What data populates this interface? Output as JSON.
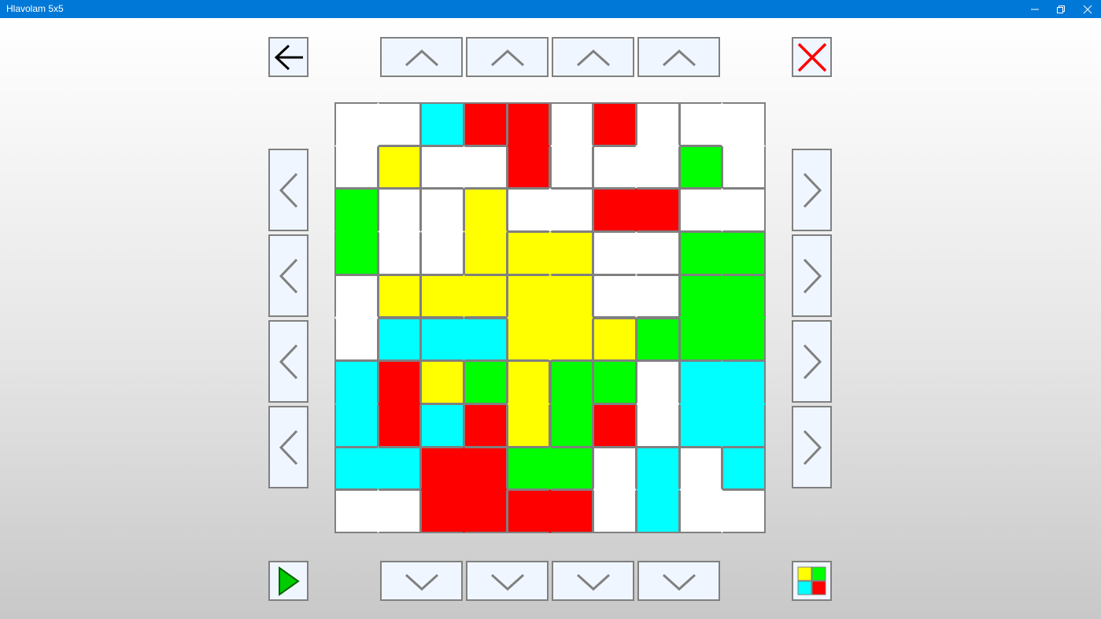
{
  "window": {
    "title": "Hlavolam 5x5",
    "controls": [
      "minimize-icon",
      "restore-icon",
      "close-icon"
    ]
  },
  "toolbar": {
    "back_icon": "arrow-left-icon",
    "close_icon": "red-x-icon",
    "play_icon": "green-play-icon",
    "colors_icon": "four-color-squares-icon"
  },
  "colors": {
    "white": "#ffffff",
    "cyan": "#00ffff",
    "red": "#ff0000",
    "yellow": "#ffff00",
    "green": "#00ff00",
    "title_bar": "#0078d7",
    "button_face": "#f0f6ff",
    "border": "#808080"
  },
  "board": {
    "grid_cells": 10,
    "pieces": [
      {
        "color": "white",
        "cells": [
          [
            0,
            0
          ],
          [
            0,
            1
          ],
          [
            1,
            0
          ]
        ]
      },
      {
        "color": "cyan",
        "cells": [
          [
            0,
            2
          ]
        ]
      },
      {
        "color": "red",
        "cells": [
          [
            0,
            3
          ]
        ]
      },
      {
        "color": "red",
        "cells": [
          [
            0,
            4
          ],
          [
            1,
            4
          ]
        ]
      },
      {
        "color": "white",
        "cells": [
          [
            0,
            5
          ],
          [
            1,
            5
          ]
        ]
      },
      {
        "color": "red",
        "cells": [
          [
            0,
            6
          ]
        ]
      },
      {
        "color": "white",
        "cells": [
          [
            0,
            7
          ],
          [
            1,
            6
          ],
          [
            1,
            7
          ]
        ]
      },
      {
        "color": "white",
        "cells": [
          [
            0,
            8
          ],
          [
            0,
            9
          ],
          [
            1,
            9
          ]
        ]
      },
      {
        "color": "yellow",
        "cells": [
          [
            1,
            1
          ]
        ]
      },
      {
        "color": "white",
        "cells": [
          [
            1,
            2
          ],
          [
            1,
            3
          ]
        ]
      },
      {
        "color": "green",
        "cells": [
          [
            1,
            8
          ]
        ]
      },
      {
        "color": "green",
        "cells": [
          [
            2,
            0
          ],
          [
            3,
            0
          ]
        ]
      },
      {
        "color": "white",
        "cells": [
          [
            2,
            1
          ],
          [
            3,
            1
          ]
        ]
      },
      {
        "color": "white",
        "cells": [
          [
            2,
            2
          ],
          [
            3,
            2
          ]
        ]
      },
      {
        "color": "yellow",
        "cells": [
          [
            2,
            3
          ],
          [
            3,
            3
          ]
        ]
      },
      {
        "color": "white",
        "cells": [
          [
            2,
            4
          ],
          [
            2,
            5
          ]
        ]
      },
      {
        "color": "red",
        "cells": [
          [
            2,
            6
          ],
          [
            2,
            7
          ]
        ]
      },
      {
        "color": "white",
        "cells": [
          [
            2,
            8
          ],
          [
            2,
            9
          ]
        ]
      },
      {
        "color": "yellow",
        "cells": [
          [
            3,
            4
          ],
          [
            3,
            5
          ]
        ]
      },
      {
        "color": "white",
        "cells": [
          [
            3,
            6
          ],
          [
            3,
            7
          ]
        ]
      },
      {
        "color": "green",
        "cells": [
          [
            3,
            8
          ],
          [
            3,
            9
          ]
        ]
      },
      {
        "color": "white",
        "cells": [
          [
            4,
            0
          ],
          [
            5,
            0
          ]
        ]
      },
      {
        "color": "yellow",
        "cells": [
          [
            4,
            1
          ]
        ]
      },
      {
        "color": "yellow",
        "cells": [
          [
            4,
            2
          ],
          [
            4,
            3
          ]
        ]
      },
      {
        "color": "yellow",
        "cells": [
          [
            4,
            4
          ],
          [
            4,
            5
          ],
          [
            5,
            4
          ],
          [
            5,
            5
          ]
        ]
      },
      {
        "color": "white",
        "cells": [
          [
            4,
            6
          ],
          [
            4,
            7
          ]
        ]
      },
      {
        "color": "green",
        "cells": [
          [
            4,
            8
          ],
          [
            4,
            9
          ],
          [
            5,
            8
          ],
          [
            5,
            9
          ]
        ]
      },
      {
        "color": "cyan",
        "cells": [
          [
            5,
            1
          ]
        ]
      },
      {
        "color": "cyan",
        "cells": [
          [
            5,
            2
          ],
          [
            5,
            3
          ]
        ]
      },
      {
        "color": "yellow",
        "cells": [
          [
            5,
            6
          ]
        ]
      },
      {
        "color": "green",
        "cells": [
          [
            5,
            7
          ]
        ]
      },
      {
        "color": "cyan",
        "cells": [
          [
            6,
            0
          ],
          [
            7,
            0
          ]
        ]
      },
      {
        "color": "red",
        "cells": [
          [
            6,
            1
          ],
          [
            7,
            1
          ]
        ]
      },
      {
        "color": "yellow",
        "cells": [
          [
            6,
            2
          ]
        ]
      },
      {
        "color": "green",
        "cells": [
          [
            6,
            3
          ]
        ]
      },
      {
        "color": "yellow",
        "cells": [
          [
            6,
            4
          ],
          [
            7,
            4
          ]
        ]
      },
      {
        "color": "green",
        "cells": [
          [
            6,
            5
          ],
          [
            7,
            5
          ]
        ]
      },
      {
        "color": "green",
        "cells": [
          [
            6,
            6
          ]
        ]
      },
      {
        "color": "white",
        "cells": [
          [
            6,
            7
          ],
          [
            7,
            7
          ]
        ]
      },
      {
        "color": "cyan",
        "cells": [
          [
            6,
            8
          ],
          [
            6,
            9
          ],
          [
            7,
            8
          ],
          [
            7,
            9
          ]
        ]
      },
      {
        "color": "cyan",
        "cells": [
          [
            7,
            2
          ]
        ]
      },
      {
        "color": "red",
        "cells": [
          [
            7,
            3
          ]
        ]
      },
      {
        "color": "red",
        "cells": [
          [
            7,
            6
          ]
        ]
      },
      {
        "color": "cyan",
        "cells": [
          [
            8,
            0
          ],
          [
            8,
            1
          ]
        ]
      },
      {
        "color": "red",
        "cells": [
          [
            8,
            2
          ],
          [
            8,
            3
          ],
          [
            9,
            2
          ],
          [
            9,
            3
          ]
        ]
      },
      {
        "color": "green",
        "cells": [
          [
            8,
            4
          ],
          [
            8,
            5
          ]
        ]
      },
      {
        "color": "white",
        "cells": [
          [
            8,
            6
          ],
          [
            9,
            6
          ]
        ]
      },
      {
        "color": "cyan",
        "cells": [
          [
            8,
            7
          ],
          [
            9,
            7
          ]
        ]
      },
      {
        "color": "white",
        "cells": [
          [
            8,
            8
          ],
          [
            9,
            8
          ],
          [
            9,
            9
          ]
        ]
      },
      {
        "color": "cyan",
        "cells": [
          [
            8,
            9
          ]
        ]
      },
      {
        "color": "white",
        "cells": [
          [
            9,
            0
          ],
          [
            9,
            1
          ]
        ]
      },
      {
        "color": "red",
        "cells": [
          [
            9,
            4
          ],
          [
            9,
            5
          ]
        ]
      }
    ]
  }
}
